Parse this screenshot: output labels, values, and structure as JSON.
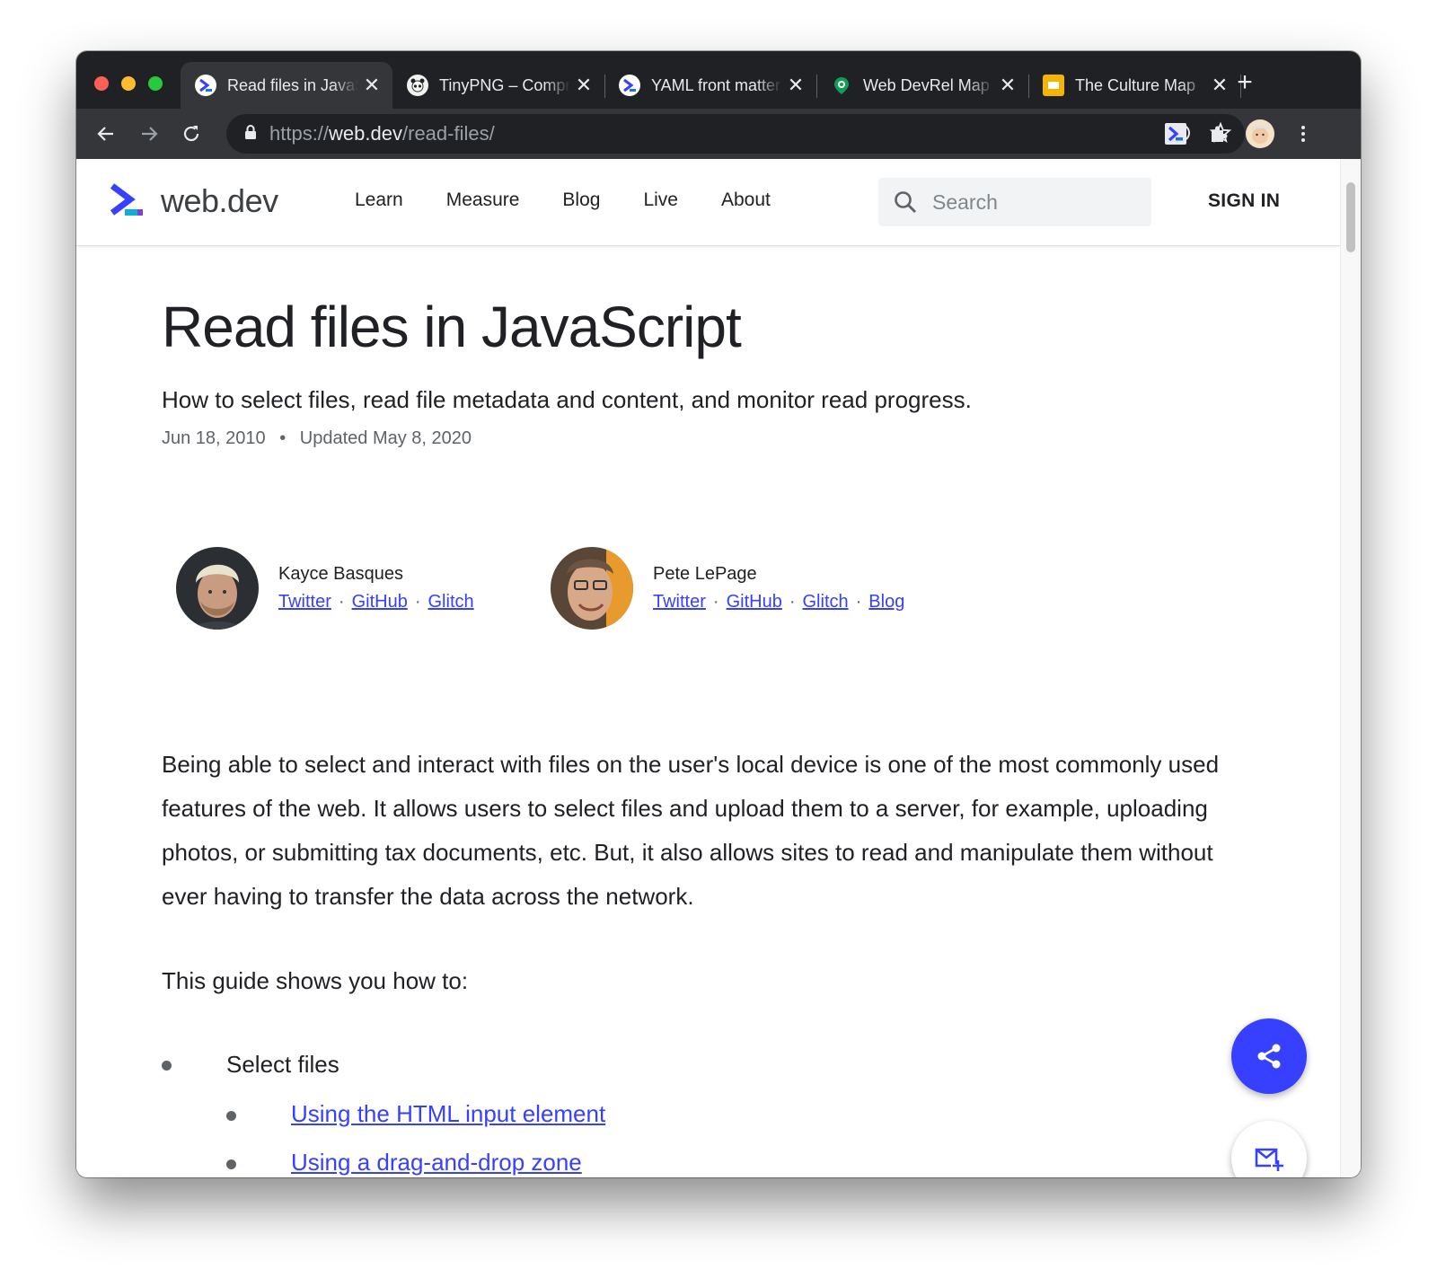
{
  "browser": {
    "tabs": [
      {
        "title": "Read files in JavaScript",
        "favicon": "webdev-icon",
        "active": true
      },
      {
        "title": "TinyPNG – Compress",
        "favicon": "panda-icon",
        "active": false
      },
      {
        "title": "YAML front matter",
        "favicon": "webdev-icon",
        "active": false
      },
      {
        "title": "Web DevRel Map",
        "favicon": "map-pin-icon",
        "active": false
      },
      {
        "title": "The Culture Map",
        "favicon": "slides-icon",
        "active": false
      }
    ],
    "close_glyph": "✕",
    "new_tab_glyph": "+",
    "url_scheme": "https://",
    "url_host": "web.dev",
    "url_path": "/read-files/"
  },
  "site": {
    "logo_text": "web.dev",
    "nav": [
      "Learn",
      "Measure",
      "Blog",
      "Live",
      "About"
    ],
    "search_placeholder": "Search",
    "signin_label": "SIGN IN"
  },
  "article": {
    "title": "Read files in JavaScript",
    "subtitle": "How to select files, read file metadata and content, and monitor read progress.",
    "published": "Jun 18, 2010",
    "date_separator": "•",
    "updated": "Updated May 8, 2020",
    "authors": [
      {
        "name": "Kayce Basques",
        "links": [
          "Twitter",
          "GitHub",
          "Glitch"
        ]
      },
      {
        "name": "Pete LePage",
        "links": [
          "Twitter",
          "GitHub",
          "Glitch",
          "Blog"
        ]
      }
    ],
    "link_separator": "·",
    "intro": "Being able to select and interact with files on the user's local device is one of the most commonly used features of the web. It allows users to select files and upload them to a server, for example, uploading photos, or submitting tax documents, etc. But, it also allows sites to read and manipulate them without ever having to transfer the data across the network.",
    "guide_intro": "This guide shows you how to:",
    "list": [
      {
        "label": "Select files",
        "children": [
          "Using the HTML input element",
          "Using a drag-and-drop zone"
        ]
      }
    ]
  },
  "colors": {
    "accent": "#3740ff",
    "chrome_dark": "#202124",
    "chrome_toolbar": "#35363a"
  }
}
